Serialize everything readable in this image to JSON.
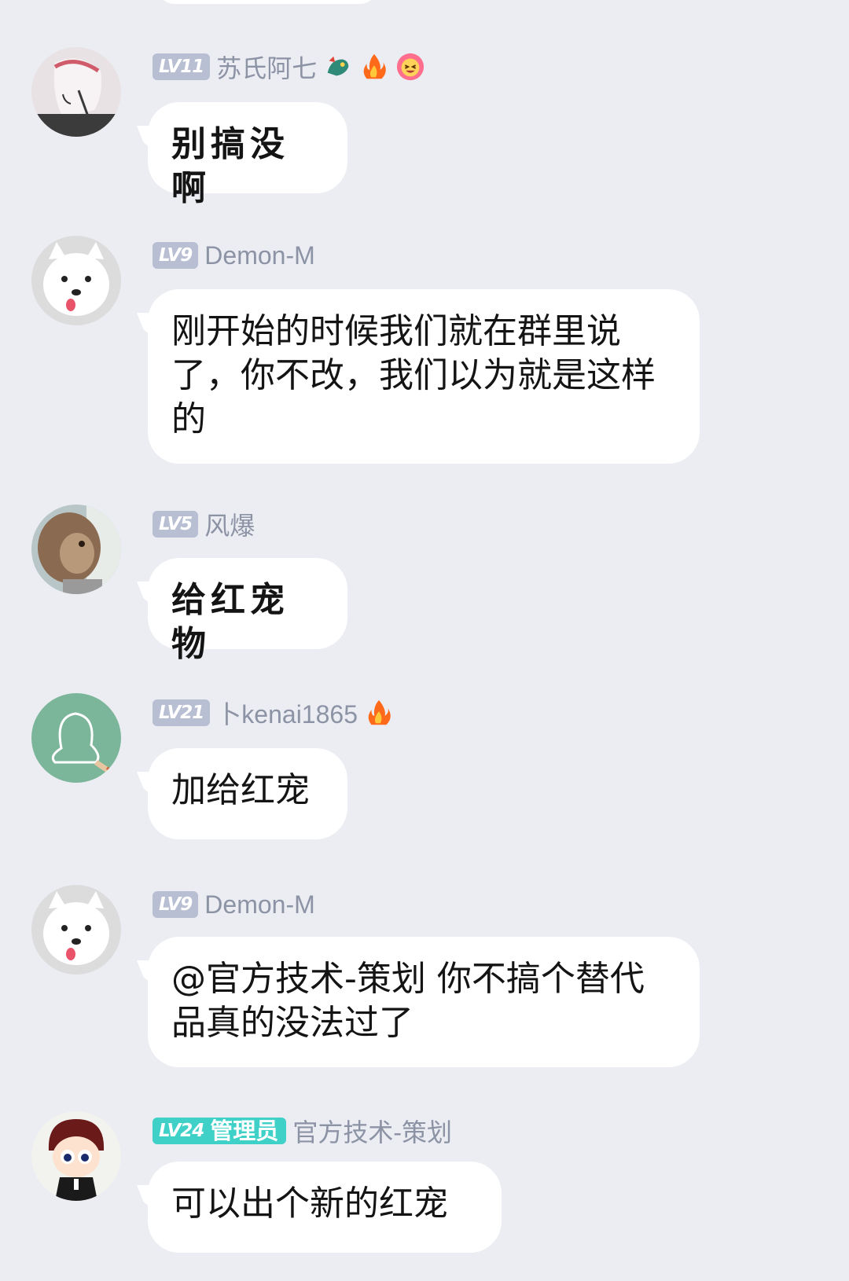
{
  "messages": [
    {
      "level": "LV11",
      "username": "苏氏阿七",
      "badges": [
        "dragon-icon",
        "fire-icon",
        "laughing-face-icon"
      ],
      "text": "别搞没啊"
    },
    {
      "level": "LV9",
      "username": "Demon-M",
      "badges": [],
      "text": "刚开始的时候我们就在群里说了，你不改，我们以为就是这样的"
    },
    {
      "level": "LV5",
      "username": "风爆",
      "badges": [],
      "text": "给红宠物"
    },
    {
      "level": "LV21",
      "username": "卜kenai1865",
      "badges": [
        "fire-icon"
      ],
      "text": "加给红宠"
    },
    {
      "level": "LV9",
      "username": "Demon-M",
      "badges": [],
      "text": "@官方技术-策划 你不搞个替代品真的没法过了"
    },
    {
      "level": "LV24",
      "role": "管理员",
      "username": "官方技术-策划",
      "badges": [],
      "text": "可以出个新的红宠"
    }
  ],
  "colors": {
    "background": "#ebedf3",
    "bubble": "#ffffff",
    "level_badge": "#b8bfd3",
    "admin_badge": "#3fd1c8",
    "username": "#8c93a5"
  }
}
